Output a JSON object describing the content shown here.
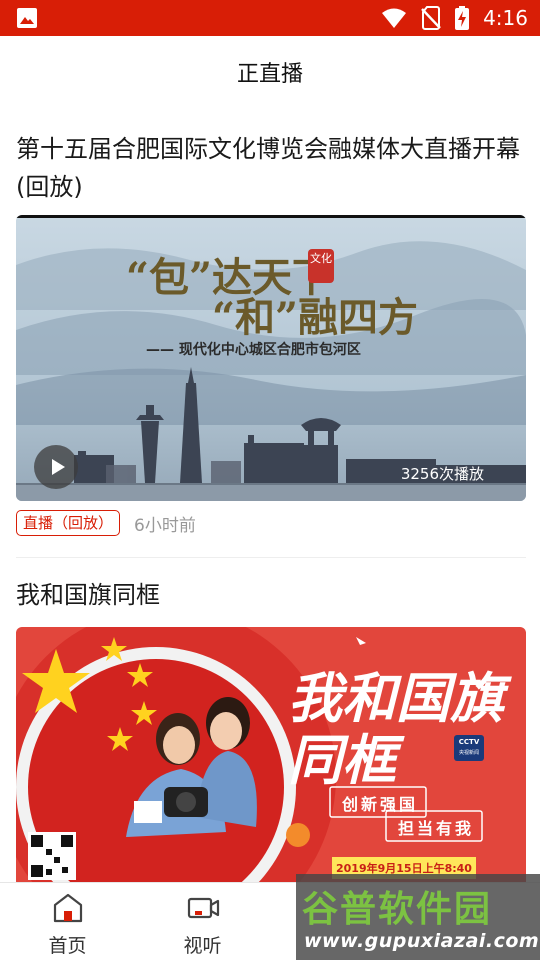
{
  "status_bar": {
    "time": "4:16",
    "icons": [
      "image-icon",
      "wifi-icon",
      "no-sim-icon",
      "battery-charging-icon"
    ]
  },
  "header": {
    "title": "正直播"
  },
  "feed": {
    "items": [
      {
        "title": "第十五届合肥国际文化博览会融媒体大直播开幕(回放)",
        "thumbnail": {
          "slogan_line1_a": "“包”达天下",
          "slogan_line2_a": "“和”融四方",
          "seal_text": "文化",
          "subtitle": "—— 现代化中心城区合肥市包河区",
          "play_count": "3256次播放"
        },
        "tag": "直播（回放）",
        "time_ago": "6小时前"
      },
      {
        "title": "我和国旗同框",
        "thumbnail": {
          "headline": "我和国旗同框",
          "logo_text": "CCTV",
          "logo_sub": "央视新闻",
          "slogan_1": "创新强国",
          "slogan_2": "担当有我",
          "date_banner": "2019年9月15日上午8:40"
        }
      }
    ]
  },
  "bottom_nav": {
    "items": [
      {
        "label": "首页",
        "icon": "home-icon"
      },
      {
        "label": "视听",
        "icon": "video-camera-icon"
      },
      {
        "label": "",
        "icon": ""
      },
      {
        "label": "",
        "icon": ""
      }
    ]
  },
  "watermark": {
    "logo": "谷普软件园",
    "url": "www.gupuxiazai.com"
  },
  "colors": {
    "brand_red": "#d81e06",
    "tag_red": "#d81e06",
    "meta_gray": "#999999",
    "watermark_green": "#7cc242"
  }
}
